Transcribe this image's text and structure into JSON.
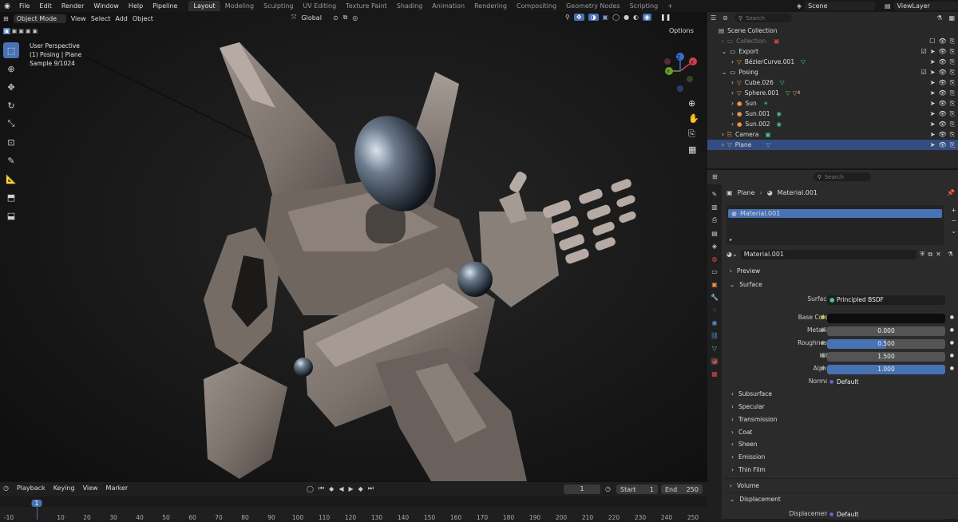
{
  "menu": {
    "items": [
      "File",
      "Edit",
      "Render",
      "Window",
      "Help",
      "Pipeline"
    ],
    "workspaces": [
      "Layout",
      "Modeling",
      "Sculpting",
      "UV Editing",
      "Texture Paint",
      "Shading",
      "Animation",
      "Rendering",
      "Compositing",
      "Geometry Nodes",
      "Scripting"
    ],
    "active_workspace": "Layout",
    "add_workspace": "+",
    "scene": "Scene",
    "view_layer": "ViewLayer"
  },
  "viewport": {
    "mode": "Object Mode",
    "menus": [
      "View",
      "Select",
      "Add",
      "Object"
    ],
    "orientation": "Global",
    "options_label": "Options",
    "overlay_lines": [
      "User Perspective",
      "(1) Posing | Plane",
      "Sample 9/1024"
    ],
    "gizmo_axes": {
      "x": "X",
      "y": "Y",
      "z": "Z"
    }
  },
  "timeline": {
    "menus": [
      "Playback",
      "Keying",
      "View",
      "Marker"
    ],
    "current_frame": "1",
    "start_label": "Start",
    "start": "1",
    "end_label": "End",
    "end": "250",
    "ruler": [
      "-10",
      "1",
      "10",
      "20",
      "30",
      "40",
      "50",
      "60",
      "70",
      "80",
      "90",
      "100",
      "110",
      "120",
      "130",
      "140",
      "150",
      "160",
      "170",
      "180",
      "190",
      "200",
      "210",
      "220",
      "230",
      "240",
      "250"
    ]
  },
  "outliner": {
    "search_placeholder": "Search",
    "rows": [
      {
        "label": "Scene Collection",
        "indent": 0
      },
      {
        "label": "Collection",
        "indent": 1,
        "dim": true
      },
      {
        "label": "Export",
        "indent": 1
      },
      {
        "label": "BézierCurve.001",
        "indent": 2
      },
      {
        "label": "Posing",
        "indent": 1
      },
      {
        "label": "Cube.026",
        "indent": 2
      },
      {
        "label": "Sphere.001",
        "indent": 2
      },
      {
        "label": "Sun",
        "indent": 2
      },
      {
        "label": "Sun.001",
        "indent": 2
      },
      {
        "label": "Sun.002",
        "indent": 2
      },
      {
        "label": "Camera",
        "indent": 1
      },
      {
        "label": "Plane",
        "indent": 1,
        "selected": true
      }
    ],
    "badge": "4"
  },
  "properties": {
    "search_placeholder": "Search",
    "breadcrumb_object": "Plane",
    "breadcrumb_material": "Material.001",
    "slot": "Material.001",
    "material_name": "Material.001",
    "sections": {
      "preview": "Preview",
      "surface": "Surface"
    },
    "surface_label": "Surface",
    "surface_value": "Principled BSDF",
    "fields": [
      {
        "label": "Base Color",
        "value": "",
        "kind": "color"
      },
      {
        "label": "Metallic",
        "value": "0.000",
        "kind": "num",
        "fill": 0
      },
      {
        "label": "Roughness",
        "value": "0.500",
        "kind": "num",
        "fill": 0.5
      },
      {
        "label": "IOR",
        "value": "1.500",
        "kind": "num",
        "fill": 0
      },
      {
        "label": "Alpha",
        "value": "1.000",
        "kind": "num",
        "fill": 1
      },
      {
        "label": "Normal",
        "value": "Default",
        "kind": "text"
      }
    ],
    "subsections": [
      "Subsurface",
      "Specular",
      "Transmission",
      "Coat",
      "Sheen",
      "Emission",
      "Thin Film"
    ],
    "volume": "Volume",
    "displacement": "Displacement",
    "displacement_label": "Displacement",
    "displacement_value": "Default"
  },
  "colors": {
    "accent": "#4772b3",
    "selected_row": "#334d80",
    "robot": "#7d736d"
  }
}
